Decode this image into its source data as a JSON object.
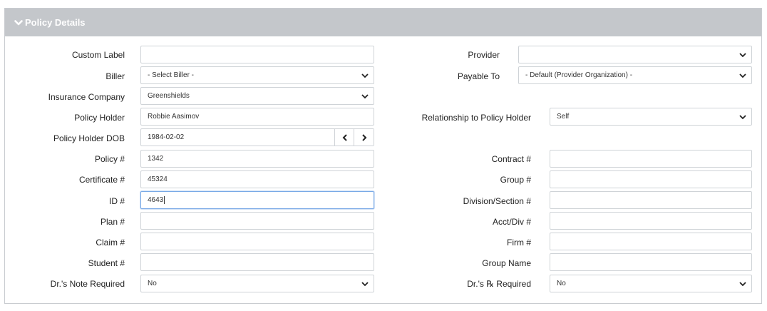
{
  "header": {
    "title": "Policy Details"
  },
  "left": [
    {
      "key": "custom_label",
      "label": "Custom Label",
      "type": "input",
      "value": ""
    },
    {
      "key": "biller",
      "label": "Biller",
      "type": "select",
      "value": "- Select Biller -"
    },
    {
      "key": "insurance_company",
      "label": "Insurance Company",
      "type": "select",
      "value": "Greenshields"
    },
    {
      "key": "policy_holder",
      "label": "Policy Holder",
      "type": "input",
      "value": "Robbie Aasimov"
    },
    {
      "key": "policy_holder_dob",
      "label": "Policy Holder DOB",
      "type": "date",
      "value": "1984-02-02"
    },
    {
      "key": "policy_num",
      "label": "Policy #",
      "type": "input",
      "value": "1342"
    },
    {
      "key": "certificate_num",
      "label": "Certificate #",
      "type": "input",
      "value": "45324"
    },
    {
      "key": "id_num",
      "label": "ID #",
      "type": "input",
      "value": "4643"
    },
    {
      "key": "plan_num",
      "label": "Plan #",
      "type": "input",
      "value": ""
    },
    {
      "key": "claim_num",
      "label": "Claim #",
      "type": "input",
      "value": ""
    },
    {
      "key": "student_num",
      "label": "Student #",
      "type": "input",
      "value": ""
    },
    {
      "key": "drs_note_required",
      "label": "Dr.'s Note Required",
      "type": "select",
      "value": "No"
    }
  ],
  "right": [
    {
      "key": "provider",
      "label": "Provider",
      "type": "select",
      "value": ""
    },
    {
      "key": "payable_to",
      "label": "Payable To",
      "type": "select",
      "value": "- Default (Provider Organization) -"
    },
    {
      "key": "relationship",
      "label": "Relationship to Policy Holder",
      "type": "select",
      "value": "Self"
    },
    {
      "key": "contract_num",
      "label": "Contract #",
      "type": "input",
      "value": ""
    },
    {
      "key": "group_num",
      "label": "Group #",
      "type": "input",
      "value": ""
    },
    {
      "key": "division_section_num",
      "label": "Division/Section #",
      "type": "input",
      "value": ""
    },
    {
      "key": "acct_div_num",
      "label": "Acct/Div #",
      "type": "input",
      "value": ""
    },
    {
      "key": "firm_num",
      "label": "Firm #",
      "type": "input",
      "value": ""
    },
    {
      "key": "group_name",
      "label": "Group Name",
      "type": "input",
      "value": ""
    },
    {
      "key": "drs_rx_required",
      "label": "Dr.'s ℞ Required",
      "type": "select",
      "value": "No"
    }
  ],
  "icons": {
    "header": "chevron-down-icon",
    "select": "chevron-down-icon",
    "prev": "chevron-left-icon",
    "next": "chevron-right-icon"
  },
  "colors": {
    "header_bg": "#c4c7cb",
    "focus_border": "#79a9e6"
  }
}
